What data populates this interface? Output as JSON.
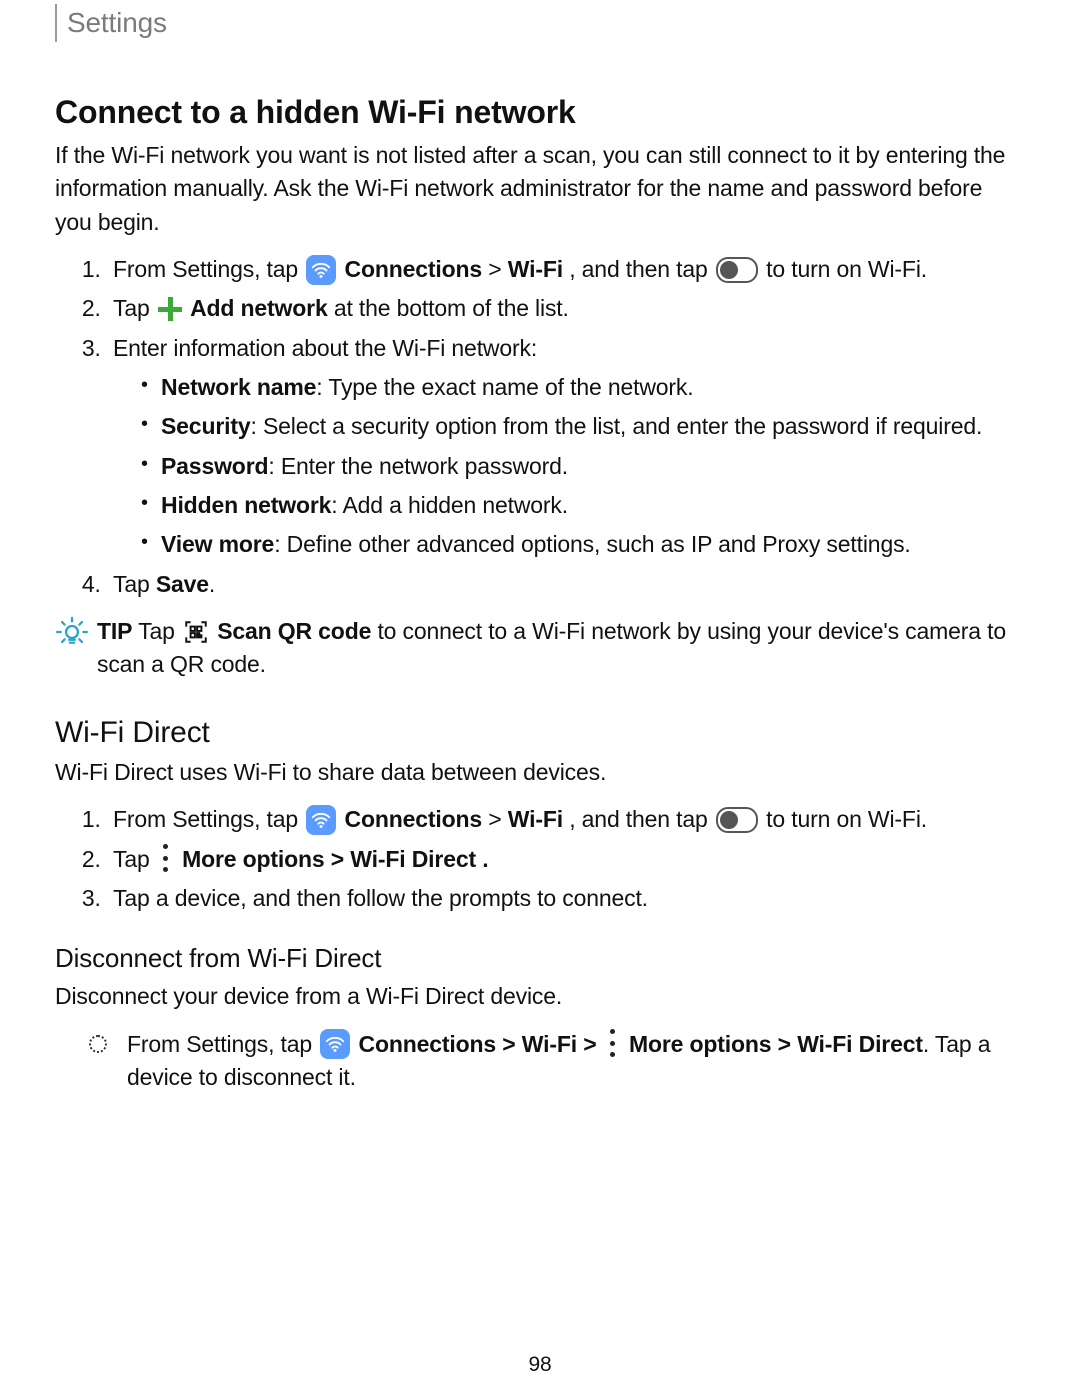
{
  "header": {
    "title": "Settings"
  },
  "section1": {
    "title": "Connect to a hidden Wi-Fi network",
    "intro": "If the Wi-Fi network you want is not listed after a scan, you can still connect to it by entering the information manually. Ask the Wi-Fi network administrator for the name and password before you begin.",
    "steps": {
      "s1_pre": "From Settings, tap ",
      "s1_connections": "Connections",
      "s1_gt_wifi": "Wi-Fi",
      "s1_mid": ", and then tap ",
      "s1_post": " to turn on Wi-Fi.",
      "s2_pre": "Tap ",
      "s2_add": "Add network",
      "s2_post": " at the bottom of the list.",
      "s3": "Enter information about the Wi-Fi network:",
      "s3_items": {
        "net_label": "Network name",
        "net_text": ": Type the exact name of the network.",
        "sec_label": "Security",
        "sec_text": ": Select a security option from the list, and enter the password if required.",
        "pwd_label": "Password",
        "pwd_text": ": Enter the network password.",
        "hid_label": "Hidden network",
        "hid_text": ": Add a hidden network.",
        "view_label": "View more",
        "view_text": ": Define other advanced options, such as IP and Proxy settings."
      },
      "s4_pre": "Tap ",
      "s4_save": "Save",
      "s4_post": "."
    },
    "tip": {
      "label": "TIP",
      "pre": "  Tap ",
      "scan": "Scan QR code",
      "post": " to connect to a Wi-Fi network by using your device's camera to scan a QR code."
    }
  },
  "section2": {
    "title": "Wi-Fi Direct",
    "intro": "Wi-Fi Direct uses Wi-Fi to share data between devices.",
    "steps": {
      "s1_pre": "From Settings, tap ",
      "s1_connections": "Connections",
      "s1_gt_wifi": "Wi-Fi",
      "s1_mid": ", and then tap ",
      "s1_post": " to turn on Wi-Fi.",
      "s2_pre": "Tap ",
      "s2_more": "More options",
      "s2_gt": " > ",
      "s2_wd": "Wi-Fi Direct",
      "s2_post": ".",
      "s3": "Tap a device, and then follow the prompts to connect."
    }
  },
  "section3": {
    "title": "Disconnect from Wi-Fi Direct",
    "intro": "Disconnect your device from a Wi-Fi Direct device.",
    "step": {
      "pre": "From Settings, tap ",
      "connections": "Connections",
      "gt1": " > ",
      "wifi": "Wi-Fi",
      "gt2": " > ",
      "more": "More options",
      "gt3": " > ",
      "wd": "Wi-Fi Direct",
      "post": ". Tap a device to disconnect it."
    }
  },
  "page_number": "98"
}
